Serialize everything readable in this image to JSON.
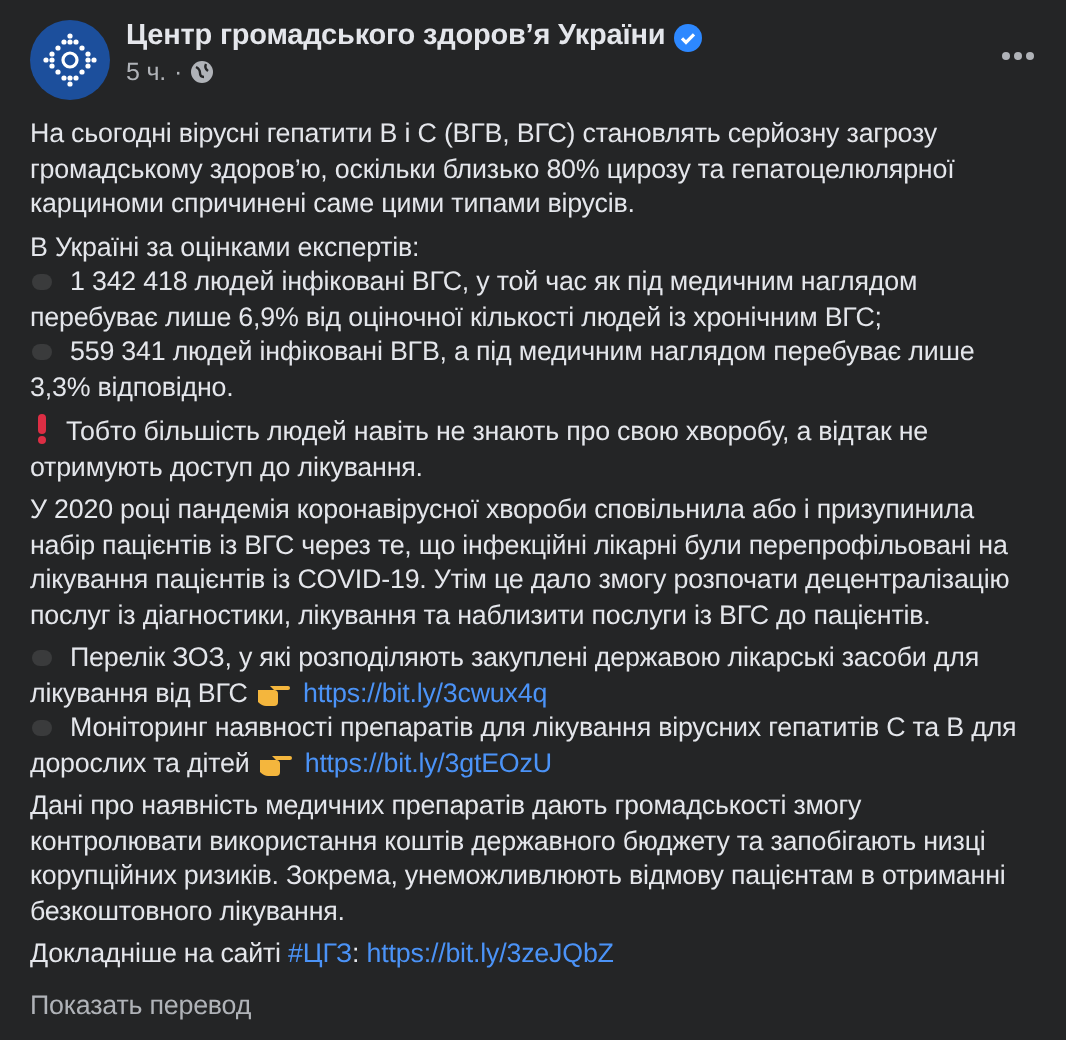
{
  "post": {
    "author": "Центр громадського здоров’я України",
    "verified": true,
    "time": "5 ч.",
    "separator": "·"
  },
  "blocks": [
    {
      "kind": "text",
      "parts": [
        {
          "kind": "text",
          "text": "На сьогодні вірусні гепатити В і С (ВГВ, ВГС) становлять серйозну загрозу громадському здоров’ю, оскільки близько 80% цирозу та гепатоцелюлярної карциноми спричинені саме цими типами вірусів."
        }
      ]
    },
    {
      "kind": "list",
      "heading": "В Україні за оцінками експертів:",
      "items": [
        {
          "text": "1 342 418 людей інфіковані ВГС, у той час як під медичним наглядом перебуває лише 6,9% від оціночної кількості людей із хронічним ВГС;"
        },
        {
          "text": "559 341 людей інфіковані ВГВ, а під медичним наглядом перебуває лише 3,3% відповідно."
        }
      ]
    },
    {
      "kind": "alert",
      "parts": [
        {
          "kind": "text",
          "text": "Тобто більшість людей навіть не знають про свою хворобу, а відтак не отримують доступ до лікування."
        }
      ]
    },
    {
      "kind": "text",
      "parts": [
        {
          "kind": "text",
          "text": "У 2020 році пандемія коронавірусної хвороби сповільнила або і призупинила набір пацієнтів із ВГС через те, що інфекційні лікарні були перепрофільовані на лікування пацієнтів із COVID-19. Утім це дало змогу розпочати децентралізацію послуг із діагностики, лікування та наблизити послуги із ВГС до пацієнтів."
        }
      ]
    },
    {
      "kind": "list",
      "items": [
        {
          "text": "Перелік ЗОЗ, у які розподіляють закуплені державою лікарські засоби для лікування від ВГС",
          "link": "https://bit.ly/3cwux4q"
        },
        {
          "text": "Моніторинг наявності препаратів для лікування вірусних гепатитів С та В для дорослих та дітей",
          "link": "https://bit.ly/3gtEOzU"
        }
      ]
    },
    {
      "kind": "text",
      "parts": [
        {
          "kind": "text",
          "text": "Дані про наявність медичних препаратів дають громадськості змогу контролювати використання коштів державного бюджету та запобігають низці корупційних ризиків. Зокрема, унеможливлюють відмову пацієнтам в отриманні безкоштовного лікування."
        }
      ]
    },
    {
      "kind": "text",
      "parts": [
        {
          "kind": "text",
          "text": "Докладніше на сайті "
        },
        {
          "kind": "hashtag",
          "text": "#ЦГЗ"
        },
        {
          "kind": "text",
          "text": ": "
        },
        {
          "kind": "link",
          "text": "https://bit.ly/3zeJQbZ"
        }
      ]
    }
  ],
  "translate": "Показать перевод"
}
